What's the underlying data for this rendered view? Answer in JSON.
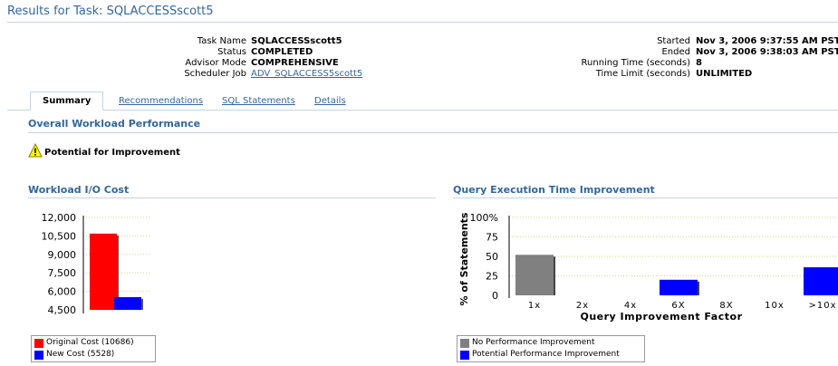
{
  "page": {
    "title": "Results for Task: SQLACCESSscott5"
  },
  "task_info": {
    "left": [
      {
        "label": "Task Name",
        "value": "SQLACCESSscott5"
      },
      {
        "label": "Status",
        "value": "COMPLETED"
      },
      {
        "label": "Advisor Mode",
        "value": "COMPREHENSIVE"
      },
      {
        "label": "Scheduler Job",
        "value": "ADV_SQLACCESS5scott5"
      }
    ],
    "right": [
      {
        "label": "Started",
        "value": "Nov 3, 2006 9:37:55 AM PST"
      },
      {
        "label": "Ended",
        "value": "Nov 3, 2006 9:38:03 AM PST"
      },
      {
        "label": "Running Time (seconds)",
        "value": "8"
      },
      {
        "label": "Time Limit (seconds)",
        "value": "UNLIMITED"
      }
    ]
  },
  "tabs": [
    {
      "label": "Summary",
      "active": true
    },
    {
      "label": "Recommendations",
      "active": false
    },
    {
      "label": "SQL Statements",
      "active": false
    },
    {
      "label": "Details",
      "active": false
    }
  ],
  "overall": {
    "heading": "Overall Workload Performance",
    "status_text": "Potential for Improvement",
    "status_icon": "warning-icon"
  },
  "colors": {
    "accent": "#336699",
    "original": "#ff0000",
    "new": "#0000ff",
    "no_improvement": "#808080",
    "potential_improvement": "#0000ff",
    "gridline": "#c8d88a"
  },
  "chart_data": [
    {
      "type": "bar",
      "title": "Workload I/O Cost",
      "categories": [
        "Original Cost (10686)",
        "New Cost (5528)"
      ],
      "values": [
        10686,
        5528
      ],
      "yticks": [
        "12,000",
        "10,500",
        "9,000",
        "7,500",
        "6,000",
        "4,500"
      ],
      "ylim": [
        4500,
        12000
      ],
      "legend": [
        "Original Cost (10686)",
        "New Cost (5528)"
      ],
      "legend_placement": "bottom",
      "grid": true
    },
    {
      "type": "bar",
      "title": "Query Execution Time Improvement",
      "xlabel": "Query Improvement Factor",
      "ylabel": "% of Statements",
      "categories": [
        "1x",
        "2x",
        "4x",
        "6X",
        "8X",
        "10x",
        ">10x"
      ],
      "series": [
        {
          "name": "No Performance Improvement",
          "values": [
            52,
            0,
            0,
            0,
            0,
            0,
            0
          ]
        },
        {
          "name": "Potential Performance Improvement",
          "values": [
            0,
            0,
            0,
            20,
            0,
            0,
            36
          ]
        }
      ],
      "yticks": [
        "100%",
        "75",
        "50",
        "25",
        "0"
      ],
      "ylim": [
        0,
        100
      ],
      "legend": [
        "No Performance Improvement",
        "Potential Performance Improvement"
      ],
      "legend_placement": "bottom",
      "grid": true
    }
  ]
}
